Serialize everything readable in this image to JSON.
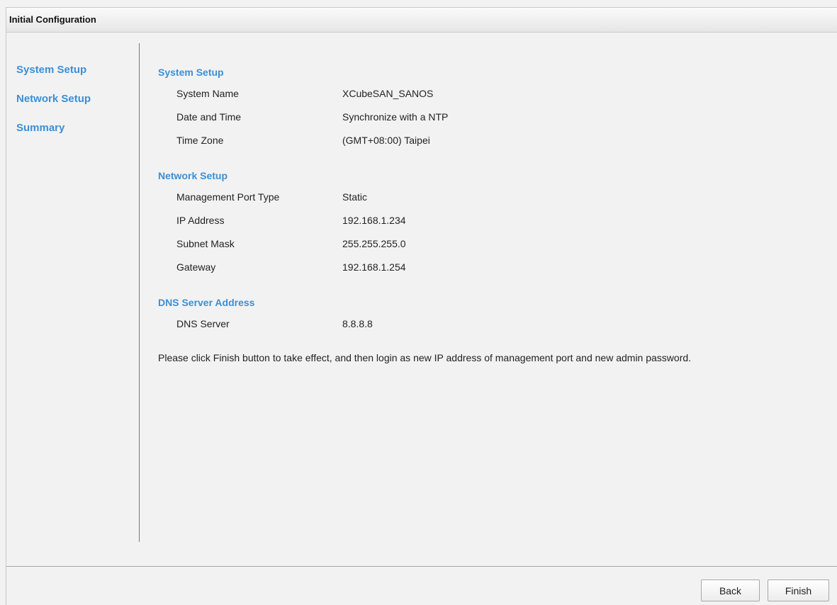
{
  "window": {
    "title": "Initial Configuration"
  },
  "nav": {
    "items": [
      {
        "label": "System Setup"
      },
      {
        "label": "Network Setup"
      },
      {
        "label": "Summary"
      }
    ]
  },
  "summary": {
    "system_setup": {
      "title": "System Setup",
      "rows": [
        {
          "label": "System Name",
          "value": "XCubeSAN_SANOS"
        },
        {
          "label": "Date and Time",
          "value": "Synchronize with a NTP"
        },
        {
          "label": "Time Zone",
          "value": "(GMT+08:00) Taipei"
        }
      ]
    },
    "network_setup": {
      "title": "Network Setup",
      "rows": [
        {
          "label": "Management Port Type",
          "value": "Static"
        },
        {
          "label": "IP Address",
          "value": "192.168.1.234"
        },
        {
          "label": "Subnet Mask",
          "value": "255.255.255.0"
        },
        {
          "label": "Gateway",
          "value": "192.168.1.254"
        }
      ]
    },
    "dns": {
      "title": "DNS Server Address",
      "rows": [
        {
          "label": "DNS Server",
          "value": "8.8.8.8"
        }
      ]
    },
    "note": "Please click Finish button to take effect, and then login as new IP address of management port and new admin password."
  },
  "buttons": {
    "back": "Back",
    "finish": "Finish"
  },
  "colors": {
    "accent": "#3b8fd6",
    "background": "#f2f2f2"
  }
}
